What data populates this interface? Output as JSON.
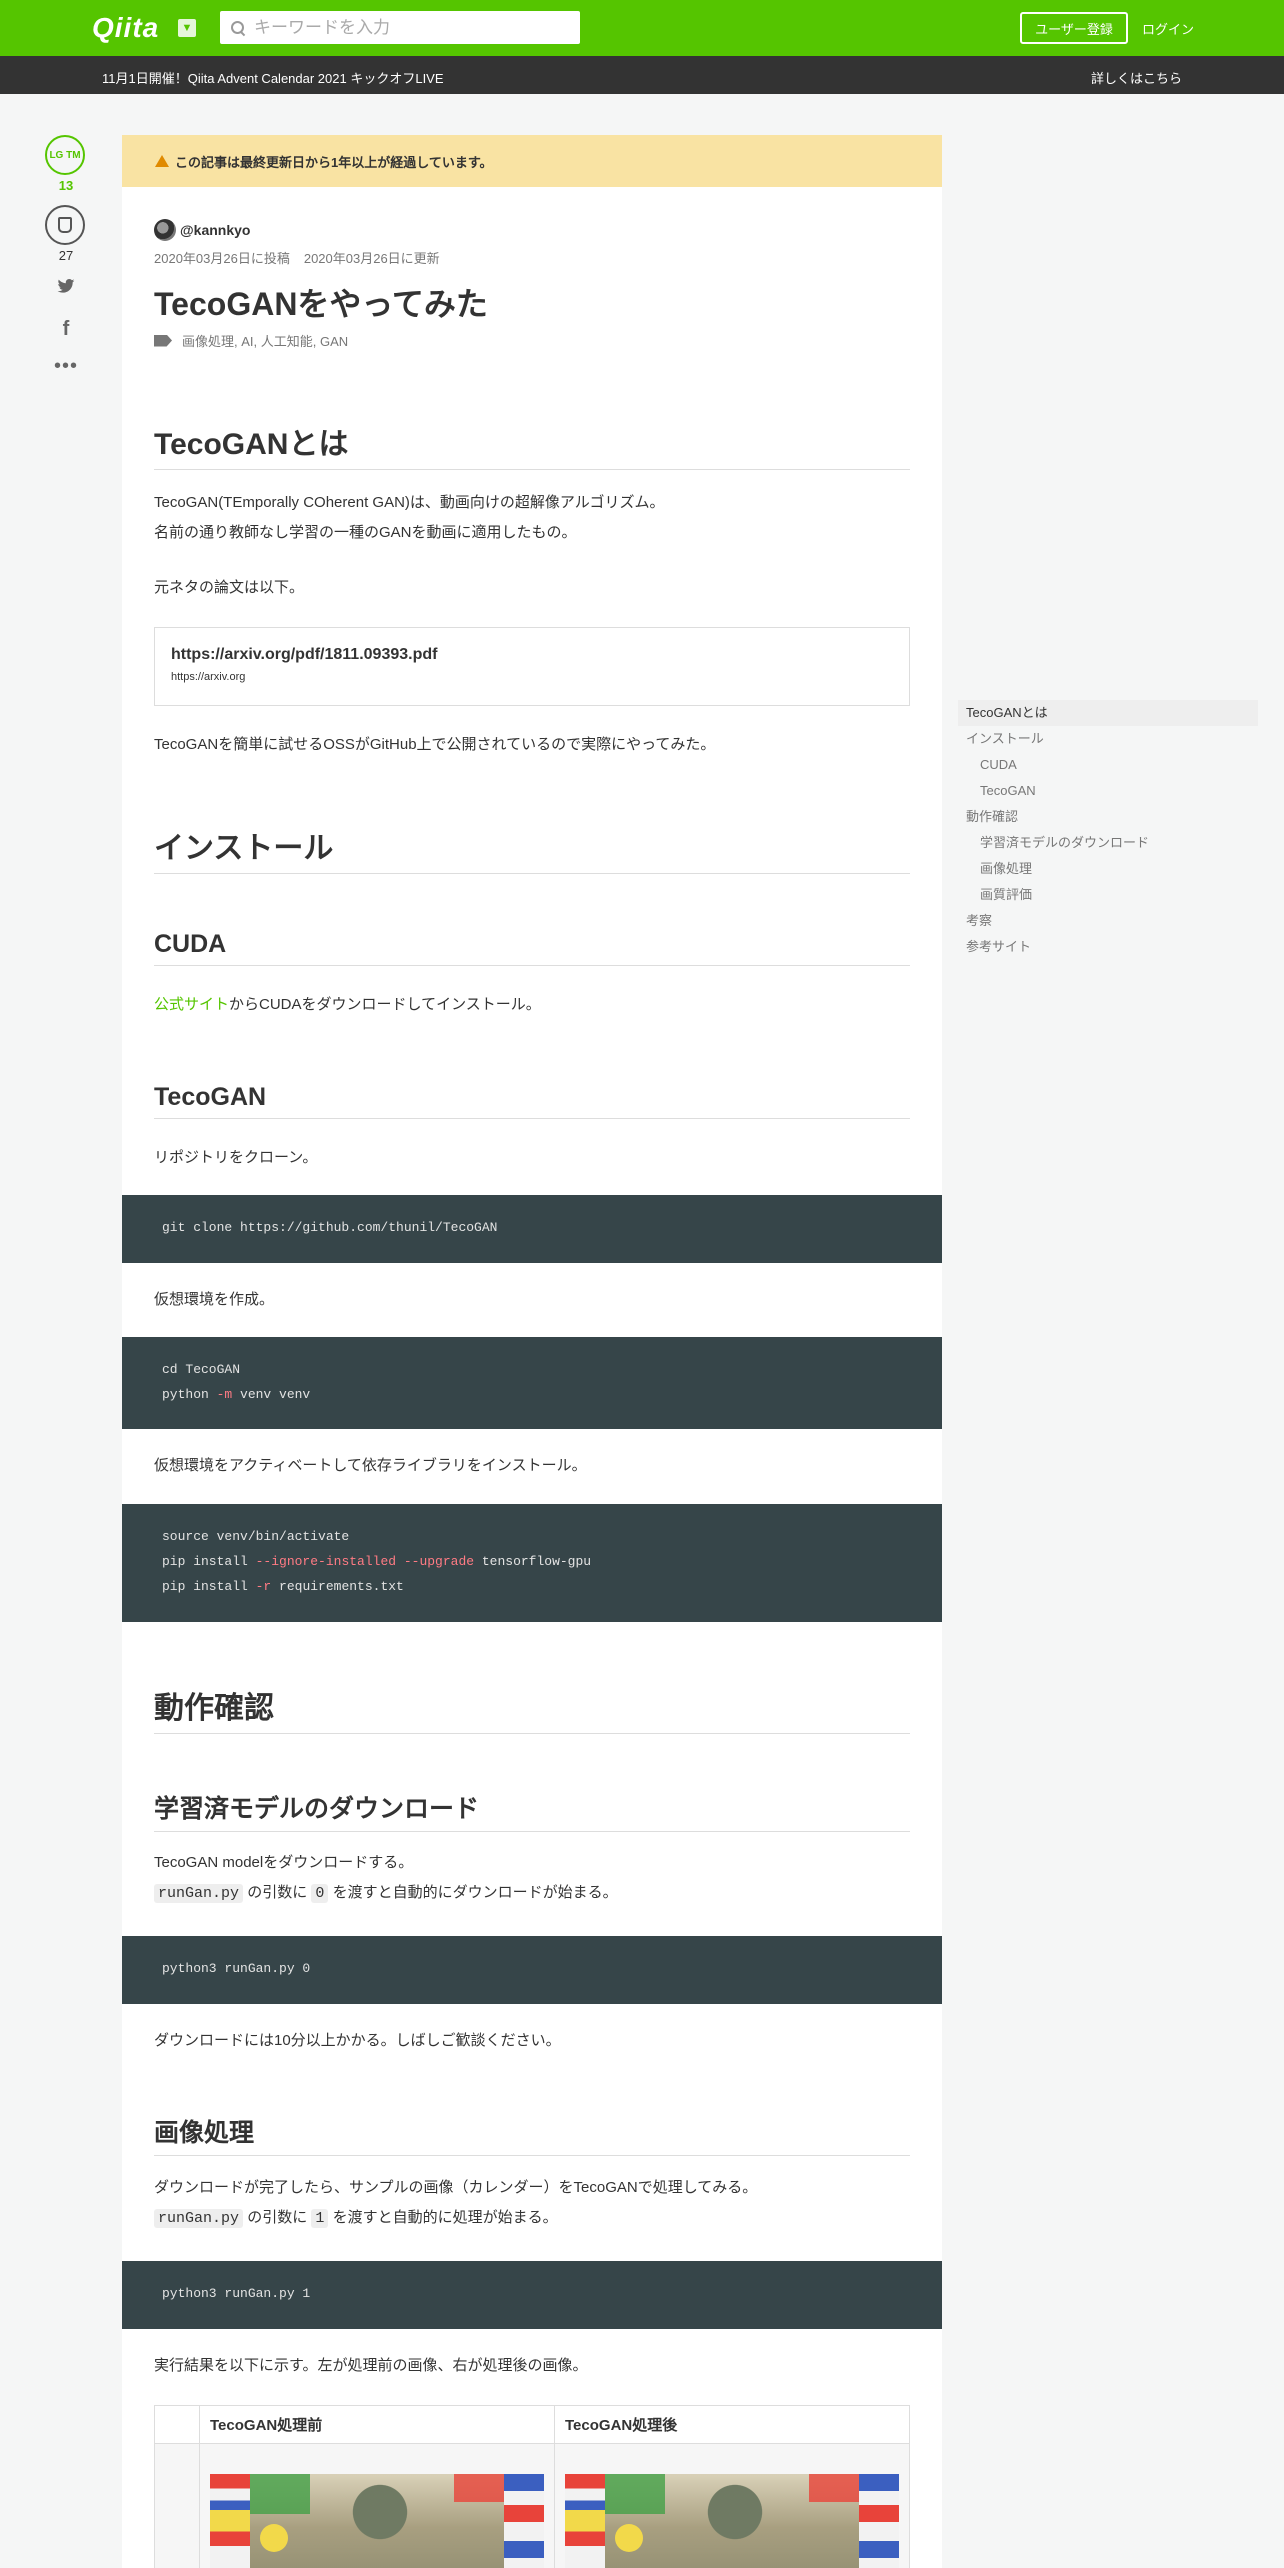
{
  "header": {
    "logo": "Qiita",
    "search_placeholder": "キーワードを入力",
    "signup_label": "ユーザー登録",
    "login_label": "ログイン",
    "brand_color": "#55c500"
  },
  "announcement": {
    "text": "11月1日開催！Qiita Advent Calendar 2021 キックオフLIVE",
    "more": "詳しくはこちら"
  },
  "side": {
    "lgtm_label": "LG TM",
    "lgtm_count": "13",
    "stock_count": "27",
    "icons": [
      "twitter-icon",
      "facebook-icon",
      "more-icon"
    ]
  },
  "article": {
    "warning": "この記事は最終更新日から1年以上が経過しています。",
    "author": "@kannkyo",
    "posted": "2020年03月26日に投稿",
    "updated": "2020年03月26日に更新",
    "title": "TecoGANをやってみた",
    "tags": "画像処理, AI, 人工知能, GAN",
    "sections": {
      "s1_title": "TecoGANとは",
      "s1_p1": "TecoGAN(TEmporally COherent GAN)は、動画向けの超解像アルゴリズム。",
      "s1_p2": "名前の通り教師なし学習の一種のGANを動画に適用したもの。",
      "s1_p3": "元ネタの論文は以下。",
      "linkcard_title": "https://arxiv.org/pdf/1811.09393.pdf",
      "linkcard_host": "https://arxiv.org",
      "s1_p4": "TecoGANを簡単に試せるOSSがGitHub上で公開されているので実際にやってみた。",
      "s2_title": "インストール",
      "s2a_title": "CUDA",
      "s2a_link": "公式サイト",
      "s2a_p": "からCUDAをダウンロードしてインストール。",
      "s2b_title": "TecoGAN",
      "s2b_p1": "リポジトリをクローン。",
      "code1": "git clone https://github.com/thunil/TecoGAN",
      "s2b_p2": "仮想環境を作成。",
      "code2_l1": "cd TecoGAN",
      "code2_l2a": "python ",
      "code2_l2b": "-m",
      "code2_l2c": " venv venv",
      "s2b_p3": "仮想環境をアクティベートして依存ライブラリをインストール。",
      "code3_l1": "source venv/bin/activate",
      "code3_l2a": "pip install ",
      "code3_l2b": "--ignore-installed --upgrade",
      "code3_l2c": " tensorflow-gpu",
      "code3_l3a": "pip install ",
      "code3_l3b": "-r",
      "code3_l3c": " requirements.txt",
      "s3_title": "動作確認",
      "s3a_title": "学習済モデルのダウンロード",
      "s3a_p1": "TecoGAN modelをダウンロードする。",
      "s3a_code_inline": "runGan.py",
      "s3a_p2a": "の引数に",
      "s3a_arg": "0",
      "s3a_p2b": "を渡すと自動的にダウンロードが始まる。",
      "code4": "python3 runGan.py 0",
      "s3a_p3": "ダウンロードには10分以上かかる。しばしご歓談ください。",
      "s3b_title": "画像処理",
      "s3b_p1": "ダウンロードが完了したら、サンプルの画像（カレンダー）をTecoGANで処理してみる。",
      "s3b_code_inline": "runGan.py",
      "s3b_p2a": "の引数に",
      "s3b_arg": "1",
      "s3b_p2b": "を渡すと自動的に処理が始まる。",
      "code5": "python3 runGan.py 1",
      "s3b_p3": "実行結果を以下に示す。左が処理前の画像、右が処理後の画像。",
      "table_h1": "TecoGAN処理前",
      "table_h2": "TecoGAN処理後"
    }
  },
  "toc": {
    "items": [
      {
        "label": "TecoGANとは"
      },
      {
        "label": "インストール"
      },
      {
        "label": "CUDA"
      },
      {
        "label": "TecoGAN"
      },
      {
        "label": "動作確認"
      },
      {
        "label": "学習済モデルのダウンロード"
      },
      {
        "label": "画像処理"
      },
      {
        "label": "画質評価"
      },
      {
        "label": "考察"
      },
      {
        "label": "参考サイト"
      }
    ]
  }
}
